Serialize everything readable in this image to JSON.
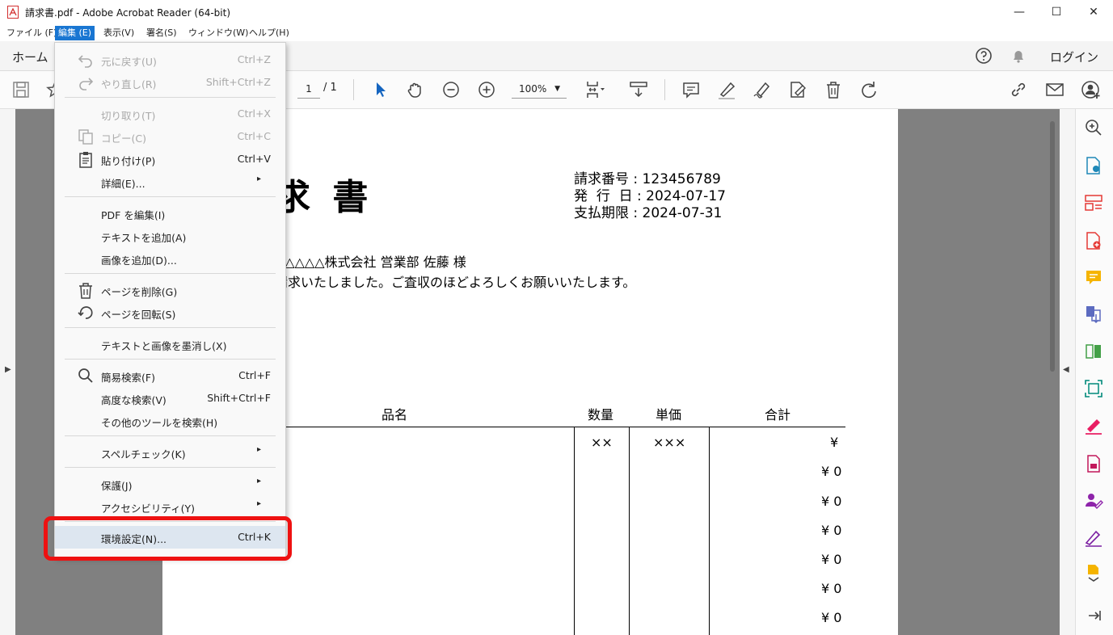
{
  "window": {
    "title": "請求書.pdf - Adobe Acrobat Reader (64-bit)",
    "minimize": "—",
    "maximize": "☐",
    "close": "✕"
  },
  "menubar": [
    "ファイル (F)",
    "編集 (E)",
    "表示(V)",
    "署名(S)",
    "ウィンドウ(W)",
    "ヘルプ(H)"
  ],
  "tabs": {
    "home": "ホーム",
    "login": "ログイン"
  },
  "toolbar": {
    "page_current": "1",
    "page_total": "/ 1",
    "zoom": "100%"
  },
  "document": {
    "title": "求 書",
    "invoice_no": "請求番号 : 123456789",
    "issue_date": "発  行  日 : 2024-07-17",
    "due_date": "支払期限 : 2024-07-31",
    "recipient": "△△△△△株式会社 営業部 佐藤 様",
    "message": "請求いたしました。ご査収のほどよろしくお願いいたします。",
    "headers": {
      "item": "品名",
      "qty": "数量",
      "price": "単価",
      "total": "合計"
    },
    "row1": {
      "qty": "××",
      "price": "×××",
      "total": "¥"
    },
    "totals": [
      "¥ 0",
      "¥ 0",
      "¥ 0",
      "¥ 0",
      "¥ 0",
      "¥ 0"
    ]
  },
  "menu": {
    "undo": {
      "label": "元に戻す(U)",
      "shortcut": "Ctrl+Z"
    },
    "redo": {
      "label": "やり直し(R)",
      "shortcut": "Shift+Ctrl+Z"
    },
    "cut": {
      "label": "切り取り(T)",
      "shortcut": "Ctrl+X"
    },
    "copy": {
      "label": "コピー(C)",
      "shortcut": "Ctrl+C"
    },
    "paste": {
      "label": "貼り付け(P)",
      "shortcut": "Ctrl+V"
    },
    "details": {
      "label": "詳細(E)..."
    },
    "edit_pdf": {
      "label": "PDF を編集(I)"
    },
    "add_text": {
      "label": "テキストを追加(A)"
    },
    "add_image": {
      "label": "画像を追加(D)..."
    },
    "delete_page": {
      "label": "ページを削除(G)"
    },
    "rotate_page": {
      "label": "ページを回転(S)"
    },
    "redact": {
      "label": "テキストと画像を墨消し(X)"
    },
    "find": {
      "label": "簡易検索(F)",
      "shortcut": "Ctrl+F"
    },
    "advanced_search": {
      "label": "高度な検索(V)",
      "shortcut": "Shift+Ctrl+F"
    },
    "search_tools": {
      "label": "その他のツールを検索(H)"
    },
    "spellcheck": {
      "label": "スペルチェック(K)"
    },
    "protection": {
      "label": "保護(J)"
    },
    "accessibility": {
      "label": "アクセシビリティ(Y)"
    },
    "preferences": {
      "label": "環境設定(N)...",
      "shortcut": "Ctrl+K"
    }
  },
  "colors": {
    "accent": "#1976d2",
    "highlight_border": "#ee1111",
    "menu_hover": "#dde6f0"
  }
}
